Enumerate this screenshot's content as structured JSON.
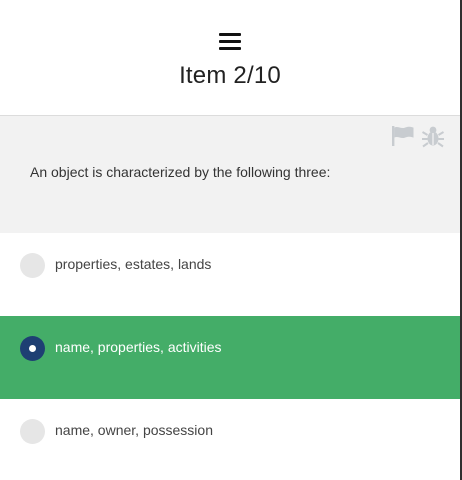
{
  "header": {
    "menu_icon": "hamburger-menu-icon",
    "title": "Item 2/10"
  },
  "question": {
    "text": "An object is characterized by the following three:",
    "icons": [
      "flag-icon",
      "bug-icon"
    ]
  },
  "options": [
    {
      "label": "properties, estates, lands",
      "selected": false
    },
    {
      "label": "name, properties, activities",
      "selected": true
    },
    {
      "label": "name, owner, possession",
      "selected": false
    }
  ],
  "colors": {
    "selected_background": "#44ad68",
    "selected_radio": "#1e3f73",
    "question_panel": "#f2f2f2",
    "icon_gray": "#c8ccd0"
  }
}
